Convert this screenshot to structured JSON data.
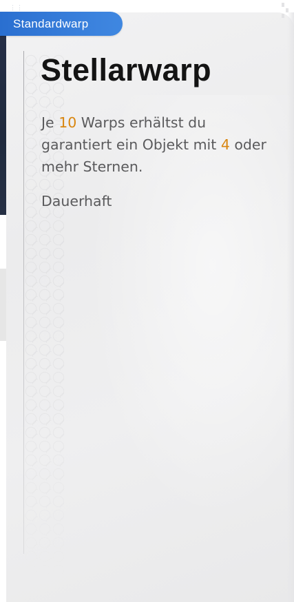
{
  "banner": {
    "label": "Standardwarp"
  },
  "card": {
    "title": "Stellarwarp",
    "description": {
      "part1": "Je ",
      "highlight1": "10",
      "part2": " Warps erhältst du garantiert ein Objekt mit ",
      "highlight2": "4",
      "part3": " oder mehr Sternen."
    },
    "duration": "Dauerhaft"
  },
  "colors": {
    "banner_blue": "#2f75d6",
    "highlight_orange": "#d9860f",
    "title_text": "#141414",
    "body_text": "#5a5a5c",
    "card_bg": "#efeff0"
  },
  "icons": {
    "corner": "grid-dots-icon"
  }
}
